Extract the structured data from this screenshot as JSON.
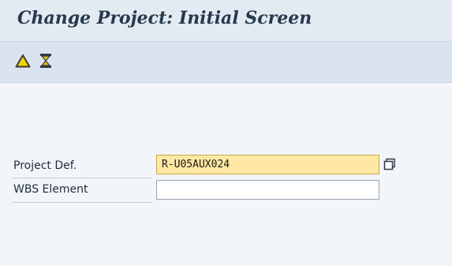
{
  "title": "Change Project: Initial Screen",
  "toolbar": {
    "buttons": [
      {
        "icon": "warning-triangle-icon",
        "color": "#f5d000"
      },
      {
        "icon": "hourglass-icon",
        "color": "#e9bd18"
      }
    ]
  },
  "fields": {
    "project_def": {
      "label": "Project Def.",
      "value": "R-U05AUX024"
    },
    "wbs_element": {
      "label": "WBS Element",
      "value": ""
    }
  },
  "colors": {
    "focused_input": "#ffe8a3",
    "title_text": "#26394d"
  }
}
